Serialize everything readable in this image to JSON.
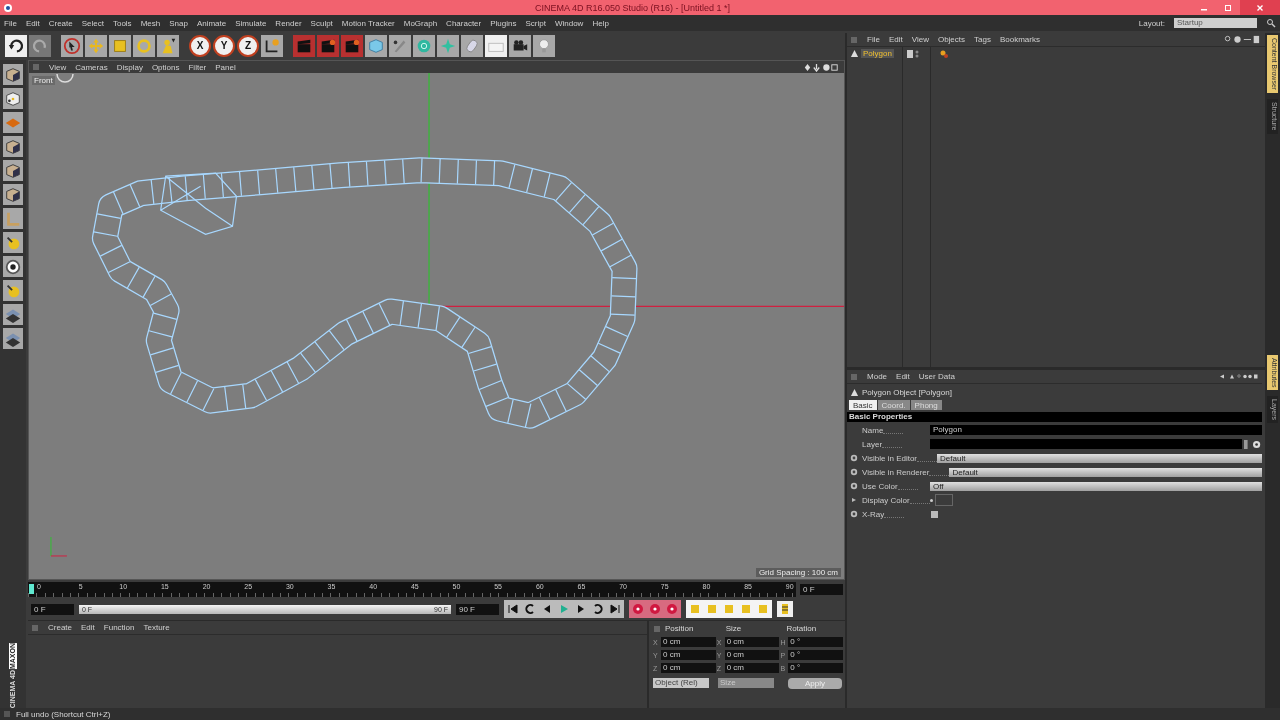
{
  "window": {
    "title": "CINEMA 4D R16.050 Studio (R16) - [Untitled 1 *]"
  },
  "menu": [
    "File",
    "Edit",
    "Create",
    "Select",
    "Tools",
    "Mesh",
    "Snap",
    "Animate",
    "Simulate",
    "Render",
    "Sculpt",
    "Motion Tracker",
    "MoGraph",
    "Character",
    "Plugins",
    "Script",
    "Window",
    "Help"
  ],
  "layout": {
    "label": "Layout:",
    "value": "Startup"
  },
  "axis_buttons": [
    "X",
    "Y",
    "Z"
  ],
  "viewport": {
    "menu": [
      "View",
      "Cameras",
      "Display",
      "Options",
      "Filter",
      "Panel"
    ],
    "camera": "Front",
    "grid_spacing": "Grid Spacing : 100 cm"
  },
  "timeline": {
    "ticks": [
      "0",
      "5",
      "10",
      "15",
      "20",
      "25",
      "30",
      "35",
      "40",
      "45",
      "50",
      "55",
      "60",
      "65",
      "70",
      "75",
      "80",
      "85",
      "90"
    ],
    "current": "0 F",
    "start": "0 F",
    "end": "90 F",
    "range_start": "0 F",
    "range_end": "90 F",
    "range": {
      "level": 1
    }
  },
  "material_manager": {
    "menu": [
      "Create",
      "Edit",
      "Function",
      "Texture"
    ]
  },
  "coordinates": {
    "headers": [
      "Position",
      "Size",
      "Rotation"
    ],
    "rows": [
      {
        "pos_axis": "X",
        "pos": "0 cm",
        "size_axis": "X",
        "size": "0 cm",
        "rot_axis": "H",
        "rot": "0 °"
      },
      {
        "pos_axis": "Y",
        "pos": "0 cm",
        "size_axis": "Y",
        "size": "0 cm",
        "rot_axis": "P",
        "rot": "0 °"
      },
      {
        "pos_axis": "Z",
        "pos": "0 cm",
        "size_axis": "Z",
        "size": "0 cm",
        "rot_axis": "B",
        "rot": "0 °"
      }
    ],
    "mode": "Object (Rel)",
    "size_mode": "Size",
    "apply": "Apply"
  },
  "object_manager": {
    "menu": [
      "File",
      "Edit",
      "View",
      "Objects",
      "Tags",
      "Bookmarks"
    ],
    "objects": [
      {
        "name": "Polygon",
        "selected": true
      }
    ]
  },
  "attributes": {
    "menu": [
      "Mode",
      "Edit",
      "User Data"
    ],
    "object_title": "Polygon Object [Polygon]",
    "tabs": [
      {
        "label": "Basic",
        "selected": true
      },
      {
        "label": "Coord.",
        "selected": false
      },
      {
        "label": "Phong",
        "selected": false
      }
    ],
    "section": "Basic Properties",
    "fields": [
      {
        "kind": "text",
        "label": "Name",
        "value": "Polygon"
      },
      {
        "kind": "link",
        "label": "Layer"
      },
      {
        "kind": "dropdown",
        "label": "Visible in Editor",
        "value": "Default"
      },
      {
        "kind": "dropdown",
        "label": "Visible in Renderer",
        "value": "Default"
      },
      {
        "kind": "dropdown",
        "label": "Use Color",
        "value": "Off"
      },
      {
        "kind": "color",
        "label": "Display Color"
      },
      {
        "kind": "checkbox",
        "label": "X-Ray",
        "checked": false
      }
    ]
  },
  "side_tabs": [
    "Content Browser",
    "Structure",
    "Attributes",
    "Layers"
  ],
  "logo": {
    "brand": "MAXON",
    "product": "CINEMA 4D"
  },
  "status_bar": "Full undo (Shortcut Ctrl+Z)"
}
